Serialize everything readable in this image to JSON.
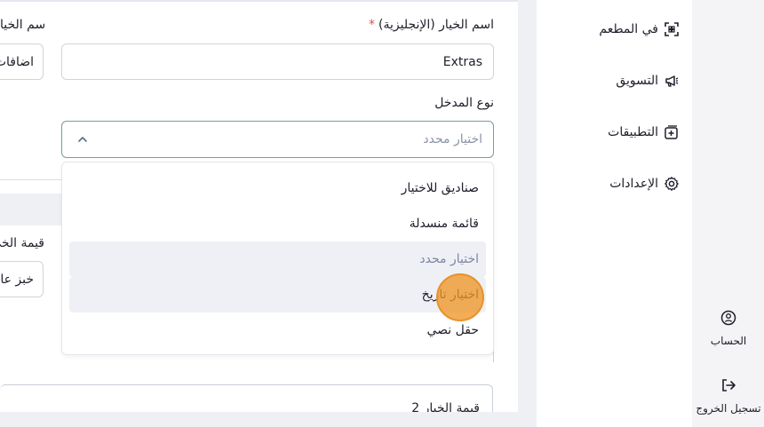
{
  "sidebar": {
    "items": [
      {
        "label": "في المطعم",
        "icon": "scan-qr-icon"
      },
      {
        "label": "التسويق",
        "icon": "megaphone-icon"
      },
      {
        "label": "التطبيقات",
        "icon": "app-add-icon"
      },
      {
        "label": "الإعدادات",
        "icon": "gear-icon"
      }
    ],
    "account": {
      "label": "الحساب",
      "icon": "account-icon"
    },
    "logout": {
      "label": "تسجيل الخروج",
      "icon": "logout-icon"
    }
  },
  "form": {
    "option_name_en_label": "اسم الخيار (الإنجليزية)",
    "option_name_en_required": "*",
    "option_name_en_value": "Extras",
    "option_name_left_label": "اسم الخيا",
    "option_name_left_value": "اضافات",
    "input_type_label": "نوع المدخل",
    "input_type_selected": "اختيار محدد",
    "input_type_options": [
      "صناديق للاختيار",
      "قائمة منسدلة",
      "اختيار محدد",
      "اختيار تاريخ",
      "حقل نصي"
    ],
    "value_left_label": "قيمة الخي",
    "value_left_field": "خبز عا",
    "option_value_2_label": "قيمة الخيار 2"
  },
  "colors": {
    "accent_border": "#7a9aa4",
    "click_marker": "#e8922c",
    "selected_option_bg": "#eef0f5"
  }
}
